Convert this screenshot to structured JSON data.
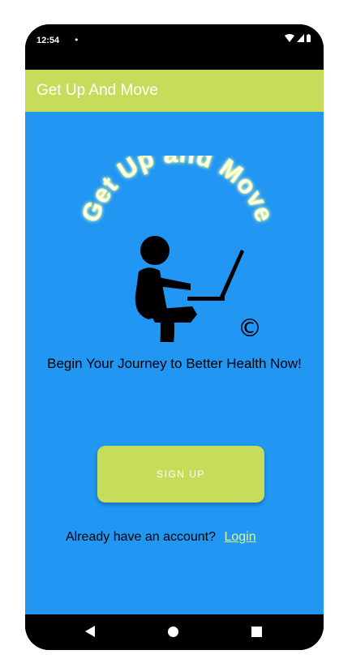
{
  "status_bar": {
    "time": "12:54",
    "notification_dot": "•"
  },
  "app_bar": {
    "title": "Get Up And Move"
  },
  "logo": {
    "text": "Get Up and Move",
    "copyright": "©"
  },
  "tagline": "Begin Your Journey to Better Health Now!",
  "signup_button": {
    "label": "SIGN UP"
  },
  "login": {
    "prompt": "Already have an account?",
    "link": "Login"
  },
  "colors": {
    "accent": "#c5dd5b",
    "background": "#2196f3",
    "link": "#d8f58a"
  }
}
